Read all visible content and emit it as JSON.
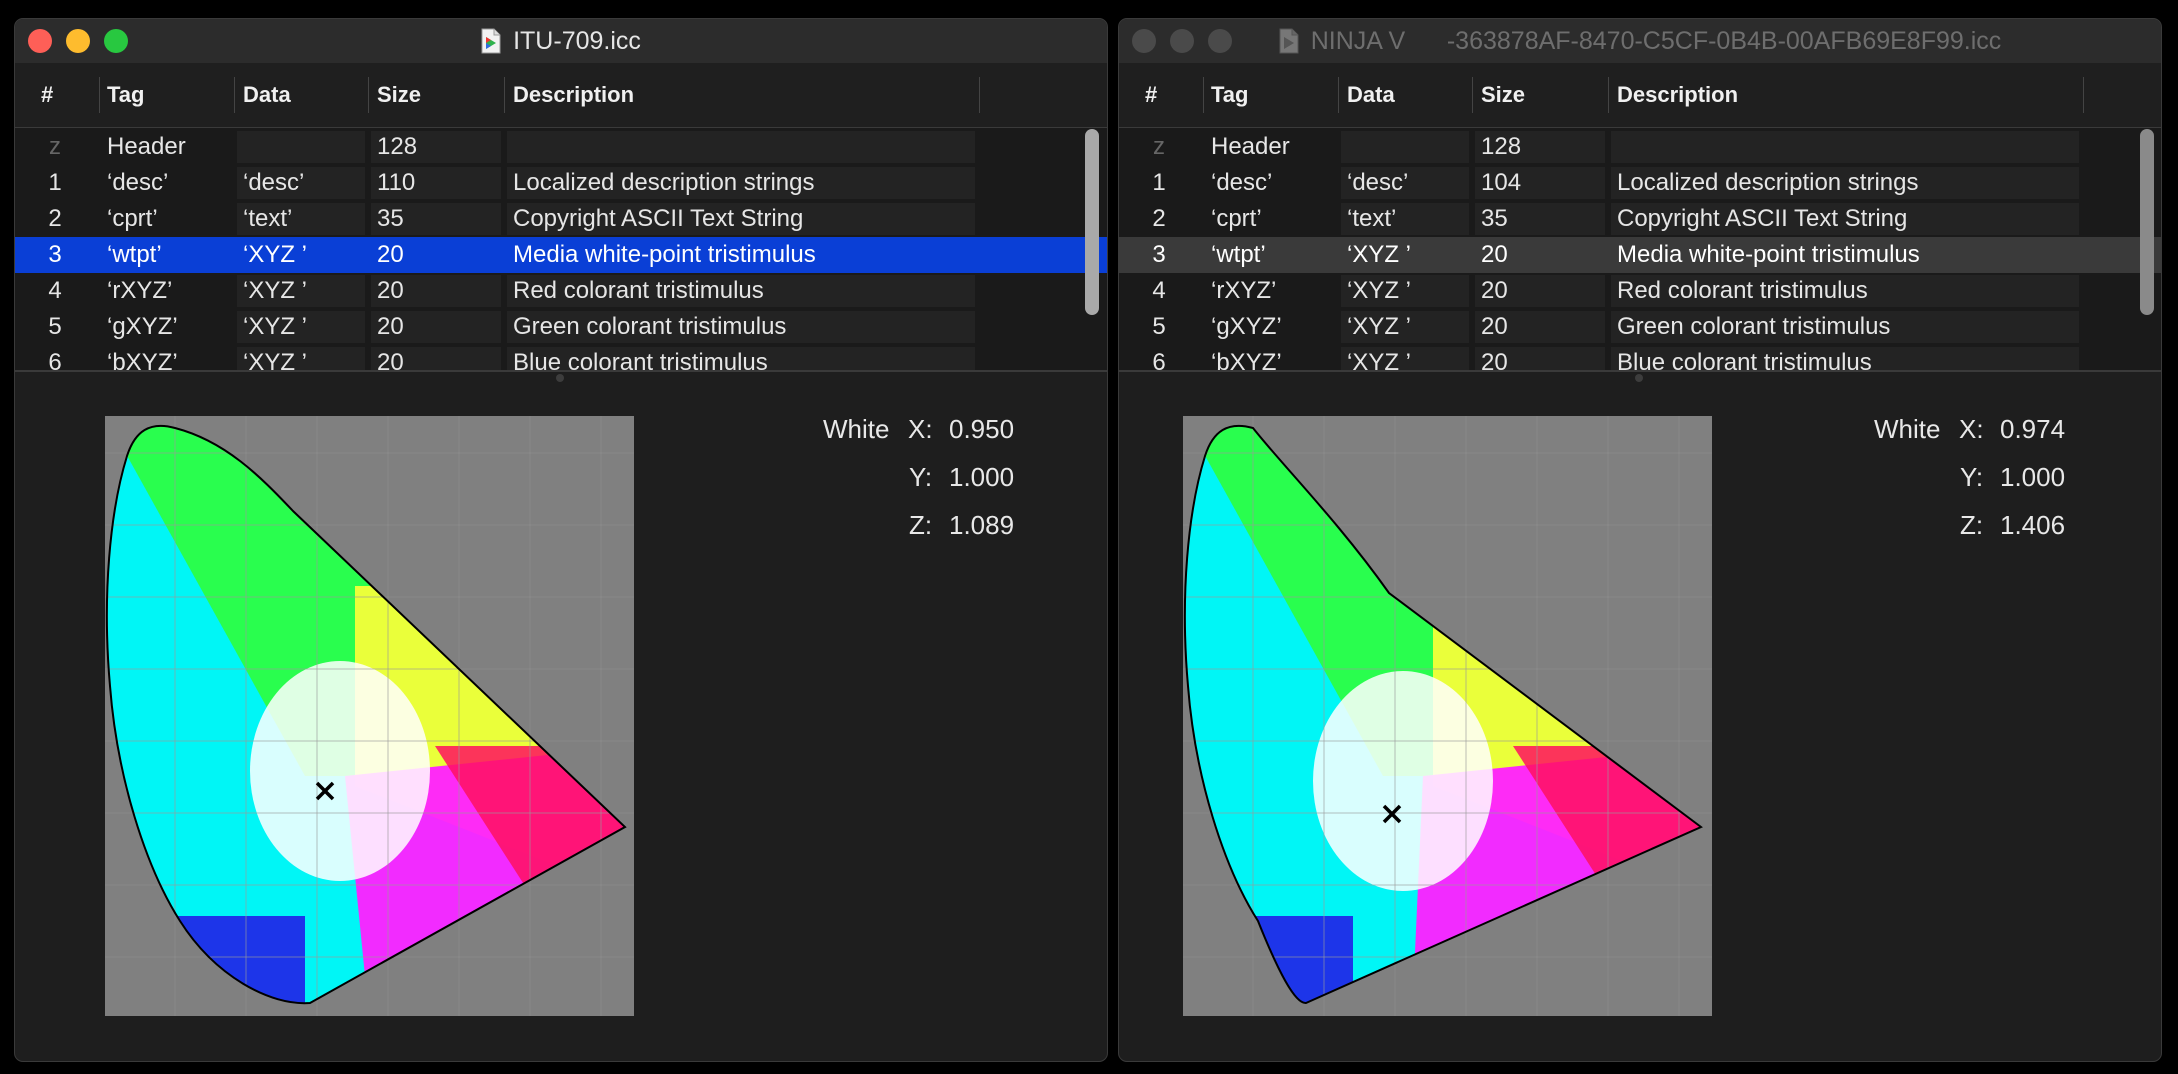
{
  "columns": {
    "num": "#",
    "tag": "Tag",
    "data": "Data",
    "size": "Size",
    "desc": "Description"
  },
  "left": {
    "title": "ITU-709.icc",
    "rows": [
      {
        "num": "z",
        "tag": "Header",
        "data": "",
        "size": "128",
        "desc": ""
      },
      {
        "num": "1",
        "tag": "‘desc’",
        "data": "‘desc’",
        "size": "110",
        "desc": "Localized description strings"
      },
      {
        "num": "2",
        "tag": "‘cprt’",
        "data": "‘text’",
        "size": "35",
        "desc": "Copyright ASCII Text String"
      },
      {
        "num": "3",
        "tag": "‘wtpt’",
        "data": "‘XYZ ’",
        "size": "20",
        "desc": "Media white-point tristimulus"
      },
      {
        "num": "4",
        "tag": "‘rXYZ’",
        "data": "‘XYZ ’",
        "size": "20",
        "desc": "Red colorant tristimulus"
      },
      {
        "num": "5",
        "tag": "‘gXYZ’",
        "data": "‘XYZ ’",
        "size": "20",
        "desc": "Green colorant tristimulus"
      },
      {
        "num": "6",
        "tag": "‘bXYZ’",
        "data": "‘XYZ ’",
        "size": "20",
        "desc": "Blue colorant tristimulus"
      }
    ],
    "selected_row": 3,
    "white": {
      "label": "White",
      "x_label": "X:",
      "x": "0.950",
      "y_label": "Y:",
      "y": "1.000",
      "z_label": "Z:",
      "z": "1.089"
    }
  },
  "right": {
    "title": "NINJA V      -363878AF-8470-C5CF-0B4B-00AFB69E8F99.icc",
    "rows": [
      {
        "num": "z",
        "tag": "Header",
        "data": "",
        "size": "128",
        "desc": ""
      },
      {
        "num": "1",
        "tag": "‘desc’",
        "data": "‘desc’",
        "size": "104",
        "desc": "Localized description strings"
      },
      {
        "num": "2",
        "tag": "‘cprt’",
        "data": "‘text’",
        "size": "35",
        "desc": "Copyright ASCII Text String"
      },
      {
        "num": "3",
        "tag": "‘wtpt’",
        "data": "‘XYZ ’",
        "size": "20",
        "desc": "Media white-point tristimulus"
      },
      {
        "num": "4",
        "tag": "‘rXYZ’",
        "data": "‘XYZ ’",
        "size": "20",
        "desc": "Red colorant tristimulus"
      },
      {
        "num": "5",
        "tag": "‘gXYZ’",
        "data": "‘XYZ ’",
        "size": "20",
        "desc": "Green colorant tristimulus"
      },
      {
        "num": "6",
        "tag": "‘bXYZ’",
        "data": "‘XYZ ’",
        "size": "20",
        "desc": "Blue colorant tristimulus"
      }
    ],
    "selected_row": 3,
    "white": {
      "label": "White",
      "x_label": "X:",
      "x": "0.974",
      "y_label": "Y:",
      "y": "1.000",
      "z_label": "Z:",
      "z": "1.406"
    }
  },
  "colors": {
    "selection_active": "#0a3fd6",
    "selection_inactive": "#3a3a3a",
    "close": "#fe5f57",
    "minimize": "#febc2e",
    "zoom": "#28c840",
    "inactive_light": "#4a4a4a"
  }
}
